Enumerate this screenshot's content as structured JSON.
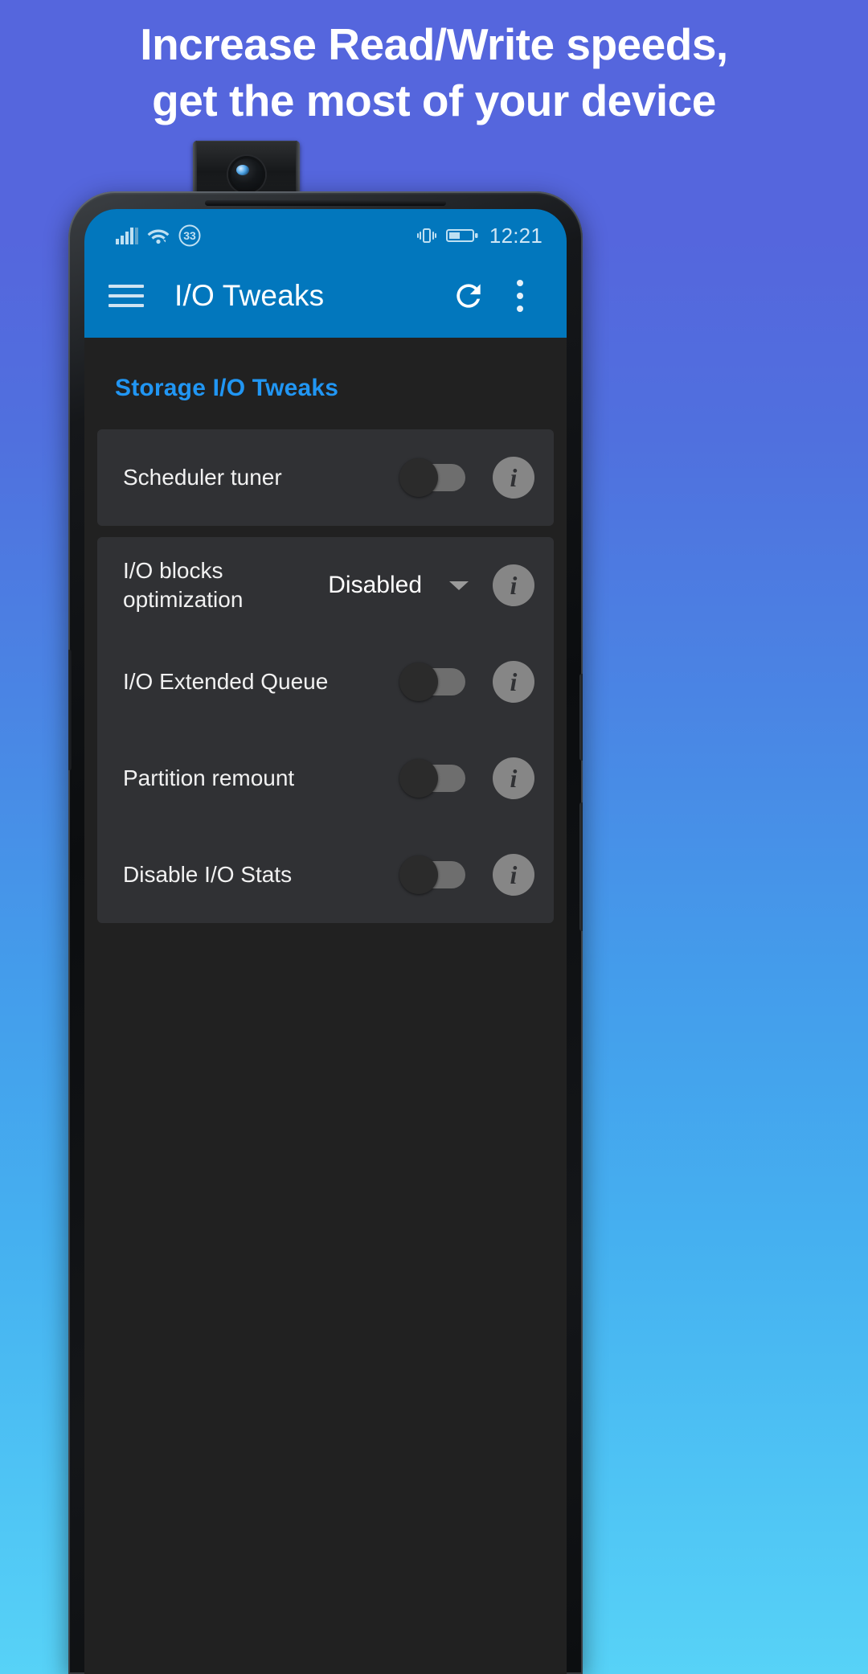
{
  "promo": {
    "line1": "Increase Read/Write speeds,",
    "line2": "get the most of your device"
  },
  "statusbar": {
    "signal_icon": "cellular-signal-icon",
    "wifi_icon": "wifi-icon",
    "badge": "33",
    "vibrate_icon": "vibrate-icon",
    "battery_icon": "battery-icon",
    "time": "12:21"
  },
  "appbar": {
    "menu_icon": "hamburger-menu-icon",
    "title": "I/O Tweaks",
    "refresh_icon": "refresh-icon",
    "overflow_icon": "more-vertical-icon",
    "background_color": "#0277BD"
  },
  "content": {
    "section_title": "Storage I/O Tweaks",
    "section_title_color": "#2196F3",
    "cards": [
      {
        "rows": [
          {
            "label": "Scheduler tuner",
            "control": "switch",
            "switch_state": "off",
            "info": "i"
          }
        ]
      },
      {
        "rows": [
          {
            "label": "I/O blocks optimization",
            "control": "spinner",
            "value": "Disabled",
            "info": "i"
          },
          {
            "label": "I/O Extended Queue",
            "control": "switch",
            "switch_state": "off",
            "info": "i"
          },
          {
            "label": "Partition remount",
            "control": "switch",
            "switch_state": "off",
            "info": "i"
          },
          {
            "label": "Disable I/O Stats",
            "control": "switch",
            "switch_state": "off",
            "info": "i"
          }
        ]
      }
    ]
  }
}
